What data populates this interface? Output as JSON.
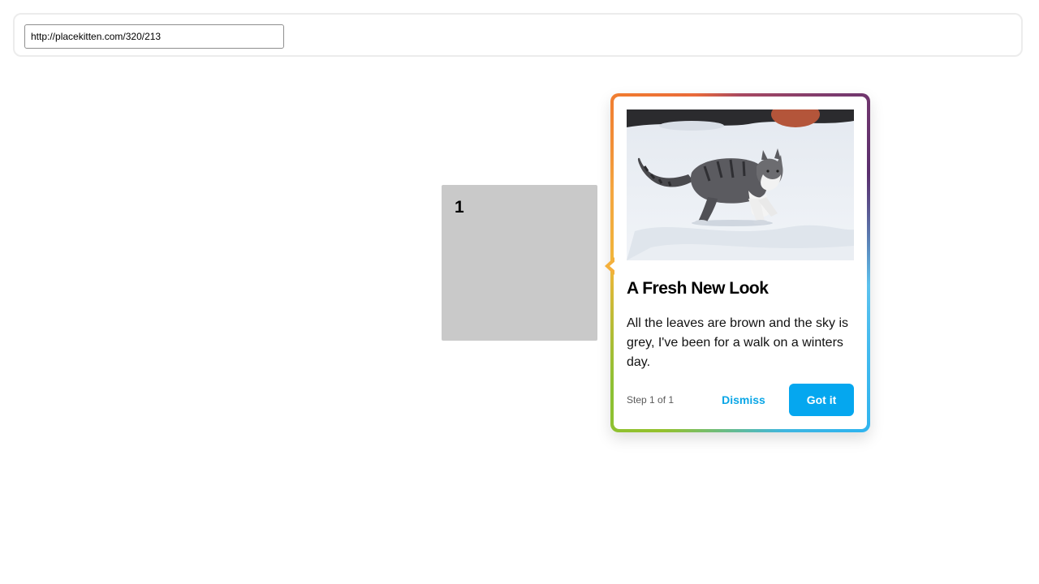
{
  "toolbar": {
    "url_value": "http://placekitten.com/320/213"
  },
  "target": {
    "number": "1"
  },
  "tour": {
    "image_icon": "kitten-in-snow-image",
    "title": "A Fresh New Look",
    "body": "All the leaves are brown and the sky is grey, I've been for a walk on a winters day.",
    "step_text": "Step 1 of 1",
    "dismiss_label": "Dismiss",
    "got_it_label": "Got it",
    "accent_color": "#05a7ef"
  }
}
